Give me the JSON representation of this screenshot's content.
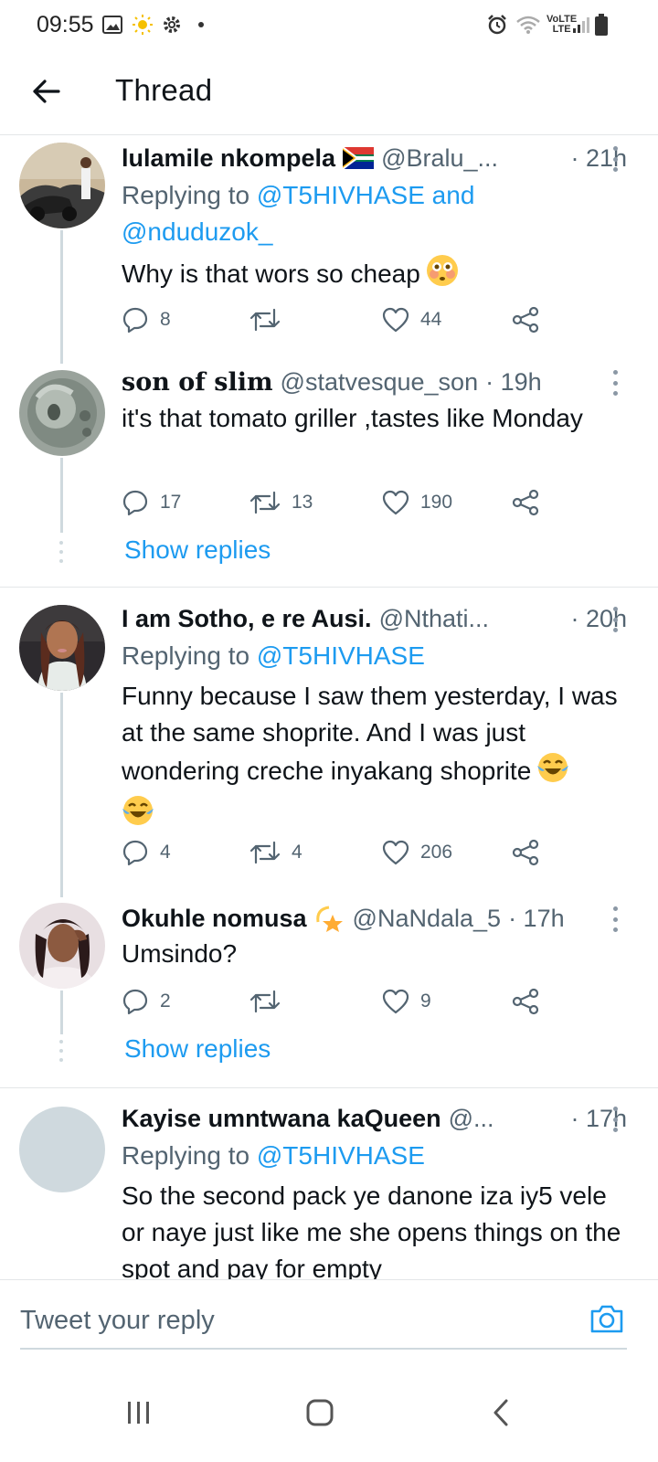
{
  "status_bar": {
    "time": "09:55",
    "network": "VoLTE",
    "lte": "LTE"
  },
  "header": {
    "title": "Thread"
  },
  "tweets": [
    {
      "name": "lulamile nkompela",
      "flag": "🇿🇦",
      "handle": "@Bralu_...",
      "time": "· 21h",
      "replying_prefix": "Replying to",
      "replying_mentions": "@T5HIVHASE and @nduduzok_",
      "text": "Why is that wors so cheap",
      "emoji": "😳",
      "replies": "8",
      "retweets": "",
      "likes": "44"
    },
    {
      "name": "son of slim",
      "handle": "@statvesque_son",
      "time": "· 19h",
      "text": "it's that tomato griller ,tastes like Monday",
      "replies": "17",
      "retweets": "13",
      "likes": "190",
      "show_replies": "Show replies"
    },
    {
      "name": "I am Sotho, e re Ausi.",
      "handle": "@Nthati...",
      "time": "· 20h",
      "replying_prefix": "Replying to",
      "replying_mentions": "@T5HIVHASE",
      "text": "Funny because I saw them yesterday, I was at the same shoprite. And I was just wondering creche inyakang shoprite",
      "emoji": "😂",
      "emoji2": "😂",
      "replies": "4",
      "retweets": "4",
      "likes": "206"
    },
    {
      "name": "Okuhle nomusa",
      "name_emoji": "💫",
      "handle": "@NaNdala_5",
      "time": "· 17h",
      "text": "Umsindo?",
      "replies": "2",
      "retweets": "",
      "likes": "9",
      "show_replies": "Show replies"
    },
    {
      "name": "Kayise umntwana kaQueen",
      "handle": "@...",
      "time": "· 17h",
      "replying_prefix": "Replying to",
      "replying_mentions": "@T5HIVHASE",
      "text": "So the second pack ye danone iza iy5 vele or naye just like me she opens things on the spot and pay for empty"
    }
  ],
  "reply_bar": {
    "placeholder": "Tweet your reply"
  },
  "colors": {
    "accent": "#1d9bf0",
    "text": "#0f1419",
    "secondary": "#536471",
    "divider": "#e3e6e8"
  }
}
